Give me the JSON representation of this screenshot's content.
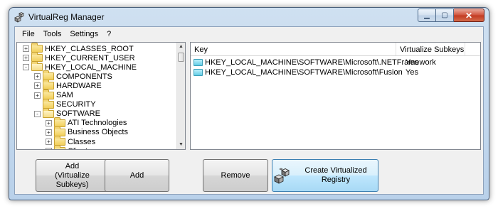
{
  "window": {
    "title": "VirtualReg Manager"
  },
  "menu": [
    "File",
    "Tools",
    "Settings",
    "?"
  ],
  "tree": [
    {
      "label": "HKEY_CLASSES_ROOT",
      "level": 0,
      "expander": "+",
      "open": false
    },
    {
      "label": "HKEY_CURRENT_USER",
      "level": 0,
      "expander": "+",
      "open": false
    },
    {
      "label": "HKEY_LOCAL_MACHINE",
      "level": 0,
      "expander": "-",
      "open": true
    },
    {
      "label": "COMPONENTS",
      "level": 1,
      "expander": "+",
      "open": false
    },
    {
      "label": "HARDWARE",
      "level": 1,
      "expander": "+",
      "open": false,
      "selected": true
    },
    {
      "label": "SAM",
      "level": 1,
      "expander": "+",
      "open": false
    },
    {
      "label": "SECURITY",
      "level": 1,
      "expander": "",
      "open": false
    },
    {
      "label": "SOFTWARE",
      "level": 1,
      "expander": "-",
      "open": true
    },
    {
      "label": "ATI Technologies",
      "level": 2,
      "expander": "+",
      "open": false
    },
    {
      "label": "Business Objects",
      "level": 2,
      "expander": "+",
      "open": false
    },
    {
      "label": "Classes",
      "level": 2,
      "expander": "+",
      "open": false
    },
    {
      "label": "Clients",
      "level": 2,
      "expander": "+",
      "open": false
    }
  ],
  "list": {
    "columns": {
      "key": "Key",
      "virtualize": "Virtualize Subkeys"
    },
    "rows": [
      {
        "key": "HKEY_LOCAL_MACHINE\\SOFTWARE\\Microsoft\\.NETFramework",
        "virtualize": "Yes"
      },
      {
        "key": "HKEY_LOCAL_MACHINE\\SOFTWARE\\Microsoft\\Fusion",
        "virtualize": "Yes"
      }
    ]
  },
  "buttons": {
    "add_virtualize": "Add (Virtualize Subkeys)",
    "add": "Add",
    "remove": "Remove",
    "create": "Create Virtualized Registry"
  },
  "icons": {
    "app": "registry-cubes-icon",
    "folder": "folder-icon",
    "list_key": "registry-key-icon",
    "create": "registry-cubes-icon"
  },
  "colors": {
    "accent_hover": "#bee6fd",
    "close_button": "#c23a22",
    "folder": "#f2cf5b",
    "list_icon": "#63cde6"
  }
}
